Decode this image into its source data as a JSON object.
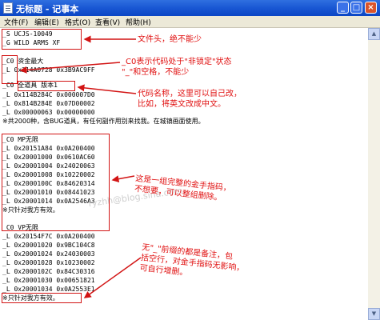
{
  "window": {
    "title": "无标题 - 记事本",
    "buttons": {
      "minimize": "_",
      "maximize": "□",
      "close": "×"
    }
  },
  "menu": [
    "文件(F)",
    "编辑(E)",
    "格式(O)",
    "查看(V)",
    "帮助(H)"
  ],
  "lines": [
    "_S UCJS-10049",
    "_G WILD ARMS XF",
    "",
    "_C0 资金最大",
    "_L 0x214A0728 0x3B9AC9FF",
    "",
    "_C0 全道具 版本1",
    "_L 0x114B284C 0x000007D0",
    "_L 0x814B284E 0x07D00002",
    "_L 0x00000063 0x00000000",
    "※共2000种，含BUG道具，有任何副作用别来找我。在城镇画面使用。",
    "",
    "_C0 MP无限",
    "_L 0x20151A84 0x0A200400",
    "_L 0x20001000 0x0610AC60",
    "_L 0x20001004 0x24020063",
    "_L 0x20001008 0x10220002",
    "_L 0x2000100C 0x84620314",
    "_L 0x20001010 0x08441023",
    "_L 0x20001014 0x0A2546A3",
    "※只针对我方有效。",
    "",
    "_C0 VP无限",
    "_L 0x20154F7C 0x0A200400",
    "_L 0x20001020 0x9BC104C8",
    "_L 0x20001024 0x24030003",
    "_L 0x20001028 0x10230002",
    "_L 0x2000102C 0x84C30316",
    "_L 0x20001030 0x00651821",
    "_L 0x20001034 0x0A2553E1",
    "※只针对我方有效。"
  ],
  "annotations": {
    "header": "文件头，绝不能少",
    "c0_note": "_C0表示代码处于\"非锁定\"状态\n\"_\"和空格，不能少",
    "name_note": "代码名称，这里可以自己改，\n比如，将英文改成中文。",
    "group_note": "这是一组完整的金手指码，\n不想要，可以整组删除。",
    "comment_note": "无\"_\"前缀的都是备注，包\n括空行，对金手指码无影响，\n可自行增删。"
  },
  "watermark": "ryzhh@blog.sina.com",
  "colors": {
    "annotation": "#e01010",
    "titlebar": "#0b46c5",
    "menubar": "#ece9d8"
  }
}
